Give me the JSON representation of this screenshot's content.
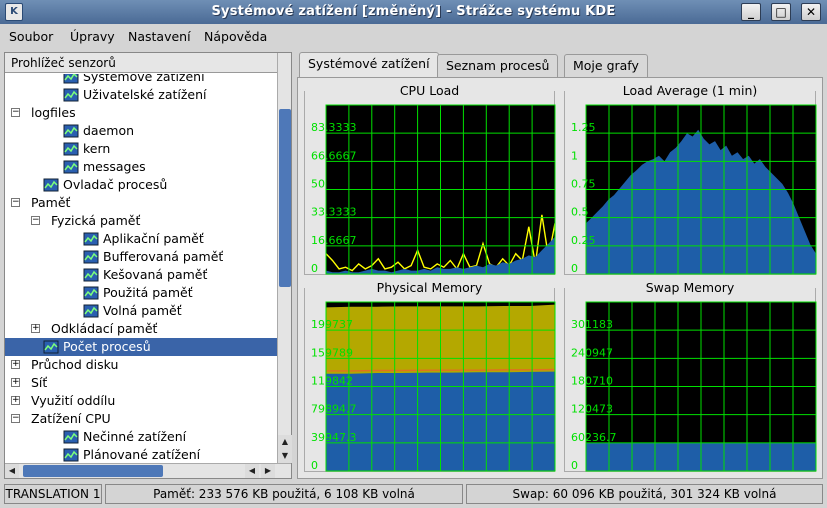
{
  "window": {
    "title": "Systémové zatížení [změněný] - Strážce systému KDE",
    "app_icon": "kde-ksysguard-icon",
    "buttons": {
      "minimize": "_",
      "maximize": "□",
      "close": "✕"
    }
  },
  "menubar": {
    "items": [
      "Soubor",
      "Úpravy",
      "Nastavení",
      "Nápověda"
    ]
  },
  "sensor_browser": {
    "header": "Prohlížeč senzorů",
    "items": [
      {
        "label": "Systémové zatížení",
        "level": 2,
        "icon": true,
        "expander": ""
      },
      {
        "label": "Uživatelské zatížení",
        "level": 2,
        "icon": true,
        "expander": ""
      },
      {
        "label": "logfiles",
        "level": 0,
        "icon": false,
        "expander": "−"
      },
      {
        "label": "daemon",
        "level": 2,
        "icon": true,
        "expander": ""
      },
      {
        "label": "kern",
        "level": 2,
        "icon": true,
        "expander": ""
      },
      {
        "label": "messages",
        "level": 2,
        "icon": true,
        "expander": ""
      },
      {
        "label": "Ovladač procesů",
        "level": 1,
        "icon": true,
        "expander": ""
      },
      {
        "label": "Paměť",
        "level": 0,
        "icon": false,
        "expander": "−"
      },
      {
        "label": "Fyzická paměť",
        "level": 1,
        "icon": false,
        "expander": "−"
      },
      {
        "label": "Aplikační paměť",
        "level": 3,
        "icon": true,
        "expander": ""
      },
      {
        "label": "Bufferovaná paměť",
        "level": 3,
        "icon": true,
        "expander": ""
      },
      {
        "label": "Kešovaná paměť",
        "level": 3,
        "icon": true,
        "expander": ""
      },
      {
        "label": "Použitá paměť",
        "level": 3,
        "icon": true,
        "expander": ""
      },
      {
        "label": "Volná paměť",
        "level": 3,
        "icon": true,
        "expander": ""
      },
      {
        "label": "Odkládací paměť",
        "level": 1,
        "icon": false,
        "expander": "+"
      },
      {
        "label": "Počet procesů",
        "level": 1,
        "icon": true,
        "expander": "",
        "selected": true
      },
      {
        "label": "Průchod disku",
        "level": 0,
        "icon": false,
        "expander": "+"
      },
      {
        "label": "Síť",
        "level": 0,
        "icon": false,
        "expander": "+"
      },
      {
        "label": "Využití oddílu",
        "level": 0,
        "icon": false,
        "expander": "+"
      },
      {
        "label": "Zatížení CPU",
        "level": 0,
        "icon": false,
        "expander": "−"
      },
      {
        "label": "Nečinné zatížení",
        "level": 2,
        "icon": true,
        "expander": ""
      },
      {
        "label": "Plánované zatížení",
        "level": 2,
        "icon": true,
        "expander": ""
      }
    ]
  },
  "tabs": [
    {
      "label": "Systémové zatížení",
      "active": true
    },
    {
      "label": "Seznam procesů",
      "active": false
    },
    {
      "label": "Moje grafy",
      "active": false
    }
  ],
  "colors": {
    "plot_bg": "#000000",
    "grid": "#00e000",
    "axis_label": "#00e000",
    "blue_fill": "#1e5ea8",
    "yellow_trace": "#ffff00",
    "olive_fill": "#b4a800",
    "orange_line": "#e07020",
    "selection": "#3a64a8"
  },
  "chart_data": [
    {
      "type": "area",
      "title": "CPU Load",
      "ylim": [
        0,
        100
      ],
      "y_ticks": [
        "0",
        "16.6667",
        "33.3333",
        "50",
        "66.6667",
        "83.3333"
      ],
      "y_tick_values": [
        0,
        16.6667,
        33.3333,
        50,
        66.6667,
        83.3333
      ],
      "grid": true,
      "series": [
        {
          "color": "#1e5ea8",
          "values": [
            2,
            1,
            1,
            2,
            1,
            1,
            2,
            3,
            2,
            2,
            1,
            2,
            3,
            2,
            2,
            3,
            2,
            4,
            3,
            3,
            4,
            3,
            4,
            5,
            4,
            6,
            5,
            7,
            6,
            8,
            9,
            11,
            10,
            14,
            18,
            22
          ]
        },
        {
          "color": "#ffff00",
          "values": [
            12,
            8,
            3,
            4,
            2,
            6,
            3,
            5,
            9,
            3,
            4,
            7,
            3,
            5,
            14,
            4,
            3,
            6,
            4,
            8,
            3,
            12,
            4,
            5,
            18,
            6,
            4,
            9,
            5,
            12,
            8,
            28,
            6,
            35,
            10,
            30
          ]
        }
      ]
    },
    {
      "type": "area",
      "title": "Load Average (1 min)",
      "ylim": [
        0,
        1.5
      ],
      "y_ticks": [
        "0",
        "0.25",
        "0.5",
        "0.75",
        "1",
        "1.25"
      ],
      "y_tick_values": [
        0,
        0.25,
        0.5,
        0.75,
        1,
        1.25
      ],
      "grid": true,
      "series": [
        {
          "color": "#1e5ea8",
          "values": [
            0.45,
            0.5,
            0.55,
            0.6,
            0.66,
            0.7,
            0.76,
            0.82,
            0.88,
            0.92,
            0.97,
            1.0,
            1.02,
            1.05,
            1.0,
            1.08,
            1.12,
            1.18,
            1.25,
            1.22,
            1.28,
            1.2,
            1.15,
            1.18,
            1.1,
            1.14,
            1.05,
            1.08,
            1.02,
            1.05,
            0.98,
            1.02,
            0.95,
            0.9,
            0.85,
            0.8,
            0.72,
            0.62,
            0.5,
            0.38,
            0.26,
            0.18
          ]
        }
      ]
    },
    {
      "type": "area",
      "title": "Physical Memory",
      "ylim": [
        0,
        239684
      ],
      "y_ticks": [
        "0",
        "39947.3",
        "79894.7",
        "119842",
        "159789",
        "199737"
      ],
      "y_tick_values": [
        0,
        39947.3,
        79894.7,
        119842,
        159789,
        199737
      ],
      "grid": true,
      "series": [
        {
          "color": "#1e5ea8",
          "values": [
            138000,
            138000,
            139000,
            139000,
            139500,
            139500,
            140000,
            140000,
            140500,
            141000
          ]
        },
        {
          "color": "#e07020",
          "values": [
            142000,
            142000,
            142500,
            142500,
            143000,
            143000,
            143000,
            143500,
            143500,
            144000
          ]
        },
        {
          "color": "#b4a800",
          "values": [
            232000,
            233000,
            233000,
            233500,
            233500,
            233500,
            233500,
            234000,
            234000,
            236000
          ]
        }
      ]
    },
    {
      "type": "area",
      "title": "Swap Memory",
      "ylim": [
        0,
        361420
      ],
      "y_ticks": [
        "0",
        "60236.7",
        "120473",
        "180710",
        "240947",
        "301183"
      ],
      "y_tick_values": [
        0,
        60236.7,
        120473,
        180710,
        240947,
        301183
      ],
      "grid": true,
      "series": [
        {
          "color": "#1e5ea8",
          "values": [
            60096,
            60096,
            60096,
            60096,
            60096,
            60096,
            60096,
            60096,
            60096,
            60096
          ]
        }
      ]
    }
  ],
  "statusbar": {
    "translation": "TRANSLATION 1",
    "memory": "Paměť: 233 576 KB použitá, 6 108 KB volná",
    "swap": "Swap: 60 096 KB použitá, 301 324 KB volná"
  }
}
